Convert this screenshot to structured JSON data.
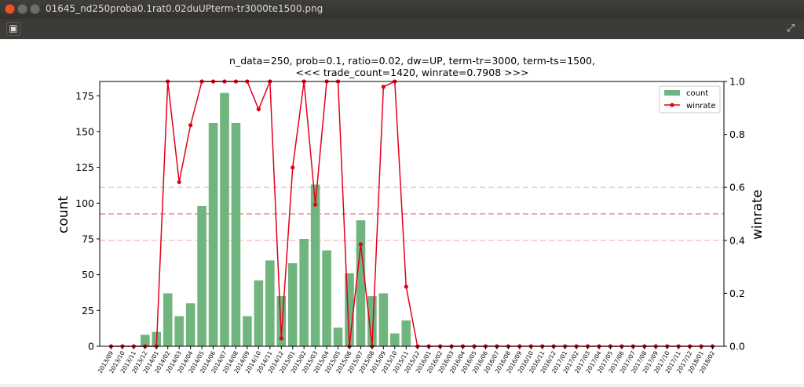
{
  "window": {
    "title": "01645_nd250proba0.1rat0.02duUPterm-tr3000te1500.png",
    "close_icon": "close-icon",
    "minimize_icon": "minimize-icon",
    "maximize_icon": "maximize-icon"
  },
  "toolbar": {
    "left_icon": "add-icon",
    "right_icon": "fullscreen-icon"
  },
  "chart_data": {
    "type": "bar",
    "title": "n_data=250, prob=0.1, ratio=0.02, dw=UP, term-tr=3000, term-ts=1500,",
    "subtitle": "<<< trade_count=1420, winrate=0.7908 >>>",
    "ylabel": "count",
    "y2label": "winrate",
    "ylim": [
      0,
      185
    ],
    "y2lim": [
      0,
      1.0
    ],
    "yticks": [
      "0",
      "25",
      "50",
      "75",
      "100",
      "125",
      "150",
      "175"
    ],
    "y2ticks": [
      "0.0",
      "0.2",
      "0.4",
      "0.6",
      "0.8",
      "1.0"
    ],
    "legend_position": "top-right",
    "reference_lines": [
      0.4,
      0.5,
      0.6
    ],
    "categories": [
      "2013/09",
      "2013/10",
      "2013/11",
      "2013/12",
      "2014/01",
      "2014/02",
      "2014/03",
      "2014/04",
      "2014/05",
      "2014/06",
      "2014/07",
      "2014/08",
      "2014/09",
      "2014/10",
      "2014/11",
      "2014/12",
      "2015/01",
      "2015/02",
      "2015/03",
      "2015/04",
      "2015/05",
      "2015/06",
      "2015/07",
      "2015/08",
      "2015/09",
      "2015/10",
      "2015/11",
      "2015/12",
      "2016/01",
      "2016/02",
      "2016/03",
      "2016/04",
      "2016/05",
      "2016/06",
      "2016/07",
      "2016/08",
      "2016/09",
      "2016/10",
      "2016/11",
      "2016/12",
      "2017/01",
      "2017/02",
      "2017/03",
      "2017/04",
      "2017/05",
      "2017/06",
      "2017/07",
      "2017/08",
      "2017/09",
      "2017/10",
      "2017/11",
      "2017/12",
      "2018/01",
      "2018/02"
    ],
    "series": [
      {
        "name": "count",
        "type": "bar",
        "color": "#70b57e",
        "values": [
          0,
          0,
          0,
          8,
          10,
          37,
          21,
          30,
          98,
          156,
          177,
          156,
          21,
          46,
          60,
          35,
          58,
          75,
          113,
          67,
          13,
          51,
          88,
          35,
          37,
          9,
          18,
          0,
          0,
          0,
          0,
          0,
          0,
          0,
          0,
          0,
          0,
          0,
          0,
          0,
          0,
          0,
          0,
          0,
          0,
          0,
          0,
          0,
          0,
          0,
          0,
          0,
          0,
          0
        ]
      },
      {
        "name": "winrate",
        "type": "line",
        "color": "#e3001b",
        "values": [
          0,
          0,
          0,
          0,
          0,
          1.0,
          0.62,
          0.835,
          1.0,
          1.0,
          1.0,
          1.0,
          1.0,
          0.895,
          1.0,
          0.03,
          0.675,
          1.0,
          0.535,
          1.0,
          1.0,
          0,
          0.385,
          0,
          0.98,
          1.0,
          0.225,
          0,
          0,
          0,
          0,
          0,
          0,
          0,
          0,
          0,
          0,
          0,
          0,
          0,
          0,
          0,
          0,
          0,
          0,
          0,
          0,
          0,
          0,
          0,
          0,
          0,
          0,
          0
        ]
      }
    ]
  }
}
